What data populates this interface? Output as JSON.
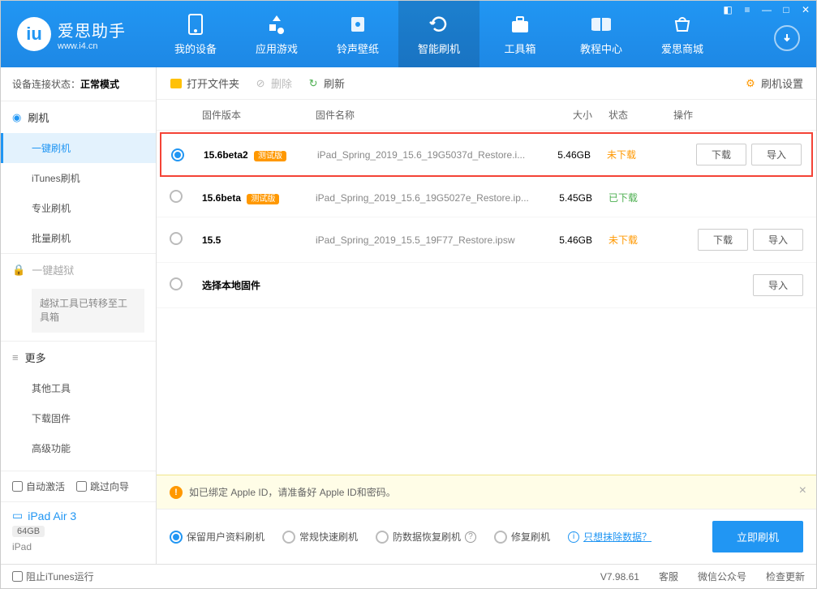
{
  "app": {
    "name": "爱思助手",
    "url": "www.i4.cn"
  },
  "nav": [
    {
      "label": "我的设备",
      "icon": "phone"
    },
    {
      "label": "应用游戏",
      "icon": "apps"
    },
    {
      "label": "铃声壁纸",
      "icon": "music"
    },
    {
      "label": "智能刷机",
      "icon": "refresh",
      "active": true
    },
    {
      "label": "工具箱",
      "icon": "toolbox"
    },
    {
      "label": "教程中心",
      "icon": "book"
    },
    {
      "label": "爱思商城",
      "icon": "shop"
    }
  ],
  "connection": {
    "label": "设备连接状态：",
    "status": "正常模式"
  },
  "sidebar": {
    "flash": {
      "title": "刷机",
      "items": [
        "一键刷机",
        "iTunes刷机",
        "专业刷机",
        "批量刷机"
      ]
    },
    "jailbreak": {
      "title": "一键越狱",
      "note": "越狱工具已转移至工具箱"
    },
    "more": {
      "title": "更多",
      "items": [
        "其他工具",
        "下载固件",
        "高级功能"
      ]
    },
    "checkboxes": {
      "auto_activate": "自动激活",
      "skip_guide": "跳过向导"
    },
    "device": {
      "name": "iPad Air 3",
      "storage": "64GB",
      "type": "iPad"
    }
  },
  "toolbar": {
    "open_folder": "打开文件夹",
    "delete": "删除",
    "refresh": "刷新",
    "settings": "刷机设置"
  },
  "columns": {
    "version": "固件版本",
    "name": "固件名称",
    "size": "大小",
    "status": "状态",
    "action": "操作"
  },
  "firmware": [
    {
      "selected": true,
      "version": "15.6beta2",
      "beta": "测试版",
      "name": "iPad_Spring_2019_15.6_19G5037d_Restore.i...",
      "size": "5.46GB",
      "status": "未下载",
      "status_class": "notdl",
      "actions": [
        "下载",
        "导入"
      ],
      "highlighted": true
    },
    {
      "selected": false,
      "version": "15.6beta",
      "beta": "测试版",
      "name": "iPad_Spring_2019_15.6_19G5027e_Restore.ip...",
      "size": "5.45GB",
      "status": "已下载",
      "status_class": "dl",
      "actions": []
    },
    {
      "selected": false,
      "version": "15.5",
      "beta": "",
      "name": "iPad_Spring_2019_15.5_19F77_Restore.ipsw",
      "size": "5.46GB",
      "status": "未下载",
      "status_class": "notdl",
      "actions": [
        "下载",
        "导入"
      ]
    },
    {
      "selected": false,
      "version": "选择本地固件",
      "beta": "",
      "name": "",
      "size": "",
      "status": "",
      "status_class": "",
      "actions": [
        "导入"
      ]
    }
  ],
  "info_bar": "如已绑定 Apple ID，请准备好 Apple ID和密码。",
  "options": {
    "keep_data": "保留用户资料刷机",
    "regular": "常规快速刷机",
    "anti_recovery": "防数据恢复刷机",
    "repair": "修复刷机",
    "erase_link": "只想抹除数据？",
    "flash_now": "立即刷机"
  },
  "footer": {
    "block_itunes": "阻止iTunes运行",
    "version": "V7.98.61",
    "support": "客服",
    "wechat": "微信公众号",
    "check_update": "检查更新"
  }
}
